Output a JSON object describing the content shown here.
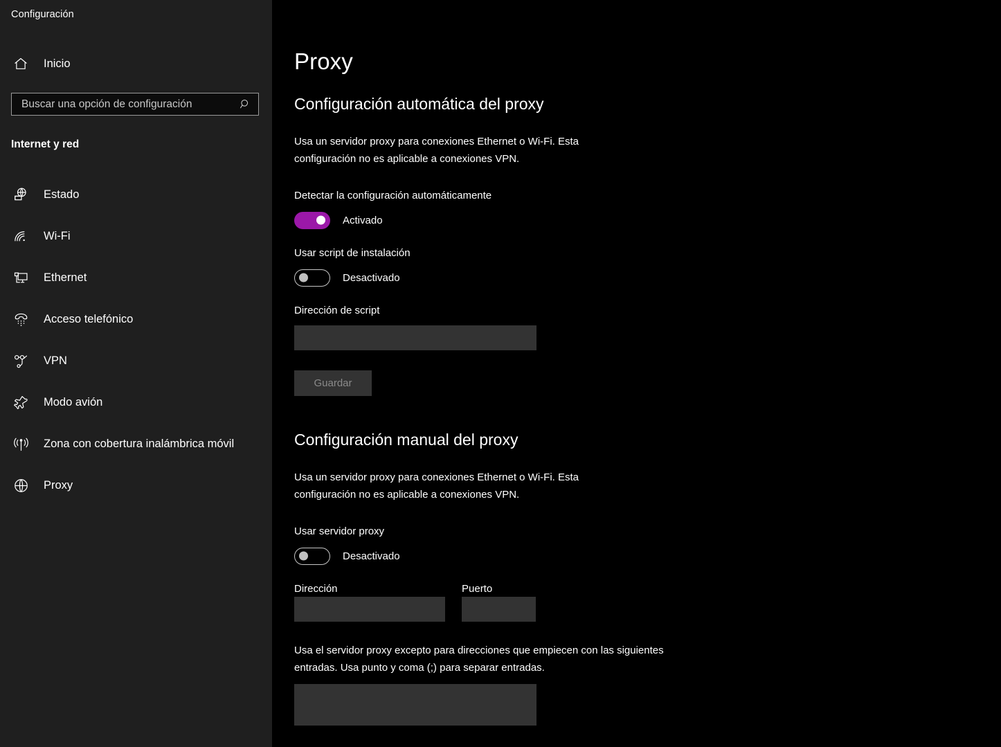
{
  "app": {
    "title": "Configuración"
  },
  "sidebar": {
    "home": {
      "label": "Inicio",
      "icon": "home-icon"
    },
    "search": {
      "placeholder": "Buscar una opción de configuración",
      "value": "",
      "icon": "search-icon"
    },
    "group_title": "Internet y red",
    "items": [
      {
        "label": "Estado",
        "icon": "network-status-icon"
      },
      {
        "label": "Wi-Fi",
        "icon": "wifi-icon"
      },
      {
        "label": "Ethernet",
        "icon": "ethernet-icon"
      },
      {
        "label": "Acceso telefónico",
        "icon": "dialup-phone-icon"
      },
      {
        "label": "VPN",
        "icon": "vpn-icon"
      },
      {
        "label": "Modo avión",
        "icon": "airplane-icon"
      },
      {
        "label": "Zona con cobertura inalámbrica móvil",
        "icon": "hotspot-icon"
      },
      {
        "label": "Proxy",
        "icon": "globe-icon"
      }
    ]
  },
  "main": {
    "page_title": "Proxy",
    "automatic": {
      "heading": "Configuración automática del proxy",
      "description": "Usa un servidor proxy para conexiones Ethernet o Wi-Fi. Esta configuración no es aplicable a conexiones VPN.",
      "detect_label": "Detectar la configuración automáticamente",
      "detect_state": "Activado",
      "script_toggle_label": "Usar script de instalación",
      "script_toggle_state": "Desactivado",
      "script_address_label": "Dirección de script",
      "script_address_value": "",
      "save_label": "Guardar"
    },
    "manual": {
      "heading": "Configuración manual del proxy",
      "description": "Usa un servidor proxy para conexiones Ethernet o Wi-Fi. Esta configuración no es aplicable a conexiones VPN.",
      "use_proxy_label": "Usar servidor proxy",
      "use_proxy_state": "Desactivado",
      "address_label": "Dirección",
      "address_value": "",
      "port_label": "Puerto",
      "port_value": "",
      "exceptions_description": "Usa el servidor proxy excepto para direcciones que empiecen con las siguientes entradas. Usa punto y coma (;) para separar entradas.",
      "exceptions_value": ""
    }
  },
  "colors": {
    "accent": "#9b18a8",
    "sidebar_bg": "#1f1f1f",
    "main_bg": "#000000",
    "field_bg": "#333333",
    "text": "#ffffff",
    "disabled_text": "#8a8a8a"
  }
}
